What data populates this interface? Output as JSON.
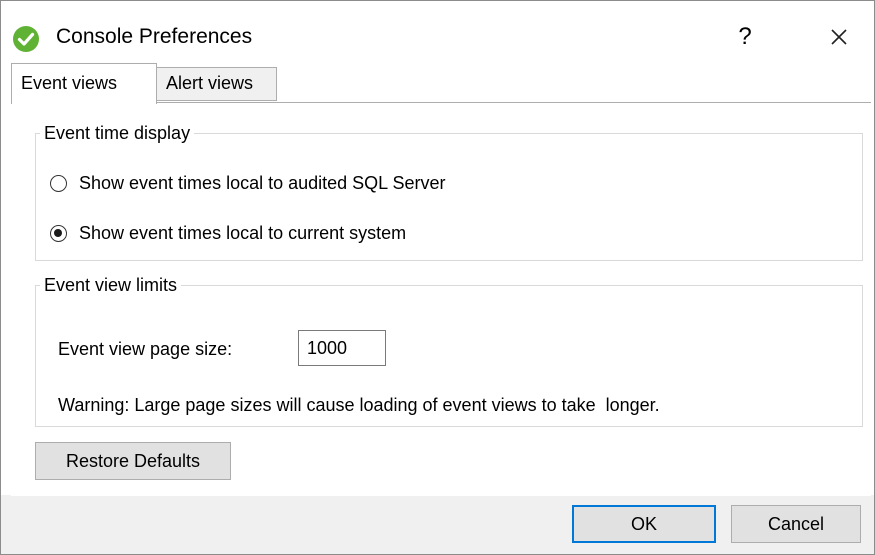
{
  "window": {
    "title": "Console Preferences",
    "help_label": "?",
    "icon": "check-circle-icon",
    "icon_color": "#5fb234"
  },
  "tabs": [
    {
      "label": "Event views",
      "active": true
    },
    {
      "label": "Alert views",
      "active": false
    }
  ],
  "event_time_display": {
    "legend": "Event time display",
    "options": [
      {
        "label": "Show event times local to audited SQL Server",
        "checked": false
      },
      {
        "label": "Show event times local to current system",
        "checked": true
      }
    ]
  },
  "event_view_limits": {
    "legend": "Event view limits",
    "page_size_label": "Event view page size:",
    "page_size_value": "1000",
    "warning": "Warning: Large page sizes will cause loading of event views to take  longer."
  },
  "buttons": {
    "restore_defaults": "Restore Defaults",
    "ok": "OK",
    "cancel": "Cancel"
  },
  "colors": {
    "accent": "#0078d7",
    "footer_bg": "#f0f0f0",
    "button_bg": "#e1e1e1"
  }
}
